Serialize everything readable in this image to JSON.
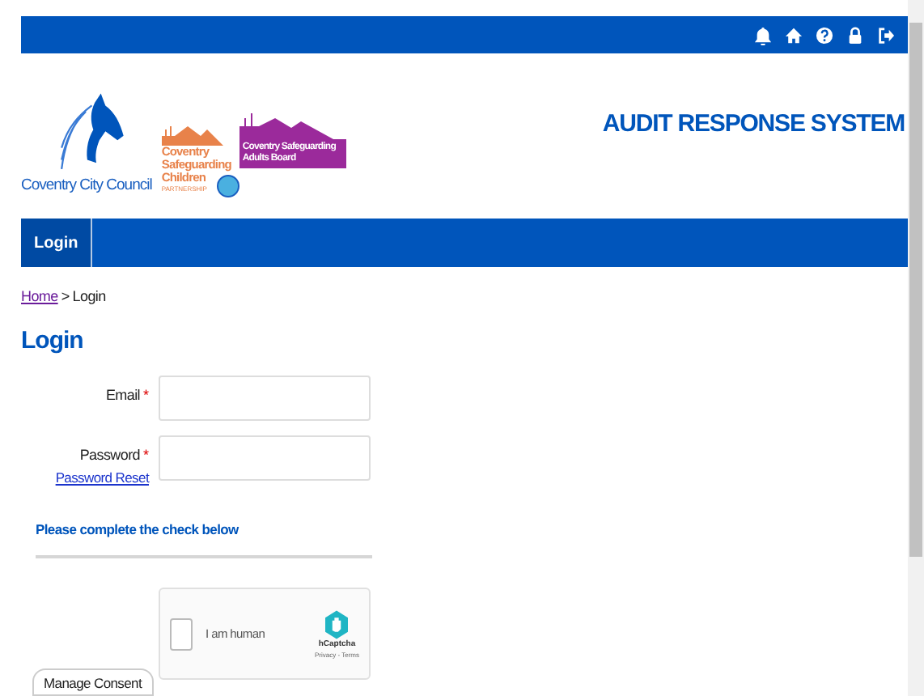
{
  "logos": [
    {
      "kind": "council",
      "text": "Coventry City Council"
    },
    {
      "kind": "children",
      "lines": [
        "Coventry",
        "Safeguarding",
        "Children"
      ],
      "sub": "PARTNERSHIP"
    },
    {
      "kind": "adults",
      "lines": [
        "Coventry Safeguarding",
        "Adults Board"
      ]
    }
  ],
  "site_title": "AUDIT RESPONSE SYSTEM",
  "nav": [
    {
      "label": "Login",
      "selected": true
    }
  ],
  "breadcrumb": {
    "link": "Home",
    "separator": ">",
    "current": "Login"
  },
  "heading": "Login",
  "form": {
    "fields": [
      {
        "label": "Email",
        "marker": "*"
      },
      {
        "label": "Password",
        "marker": "*",
        "link": "Password Reset"
      }
    ],
    "check_heading": "Please complete the check below",
    "captcha": {
      "label": "I am human",
      "checked": false,
      "brand": "hCaptcha",
      "footer": "Privacy - Terms"
    }
  },
  "consent_button": "Manage Consent"
}
